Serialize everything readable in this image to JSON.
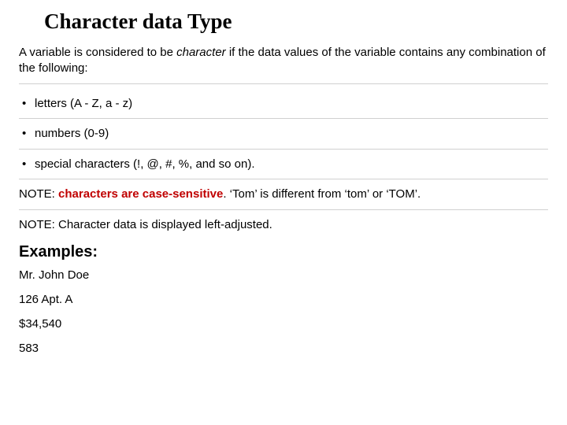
{
  "title": "Character data Type",
  "intro_prefix": "A variable is considered to be ",
  "intro_keyword": "character",
  "intro_suffix": " if the data values of the variable contains any combination of the following:",
  "bullets": [
    "letters (A - Z, a - z)",
    "numbers (0-9)",
    "special characters (!, @, #, %, and so on)."
  ],
  "note1": {
    "label": "NOTE: ",
    "highlight": "characters are case-sensitive",
    "rest": ". ‘Tom’ is different from ‘tom’ or ‘TOM’."
  },
  "note2": "NOTE: Character data is displayed left-adjusted.",
  "examples_heading": "Examples:",
  "examples": [
    "Mr. John Doe",
    "126 Apt. A",
    "$34,540",
    "583"
  ]
}
